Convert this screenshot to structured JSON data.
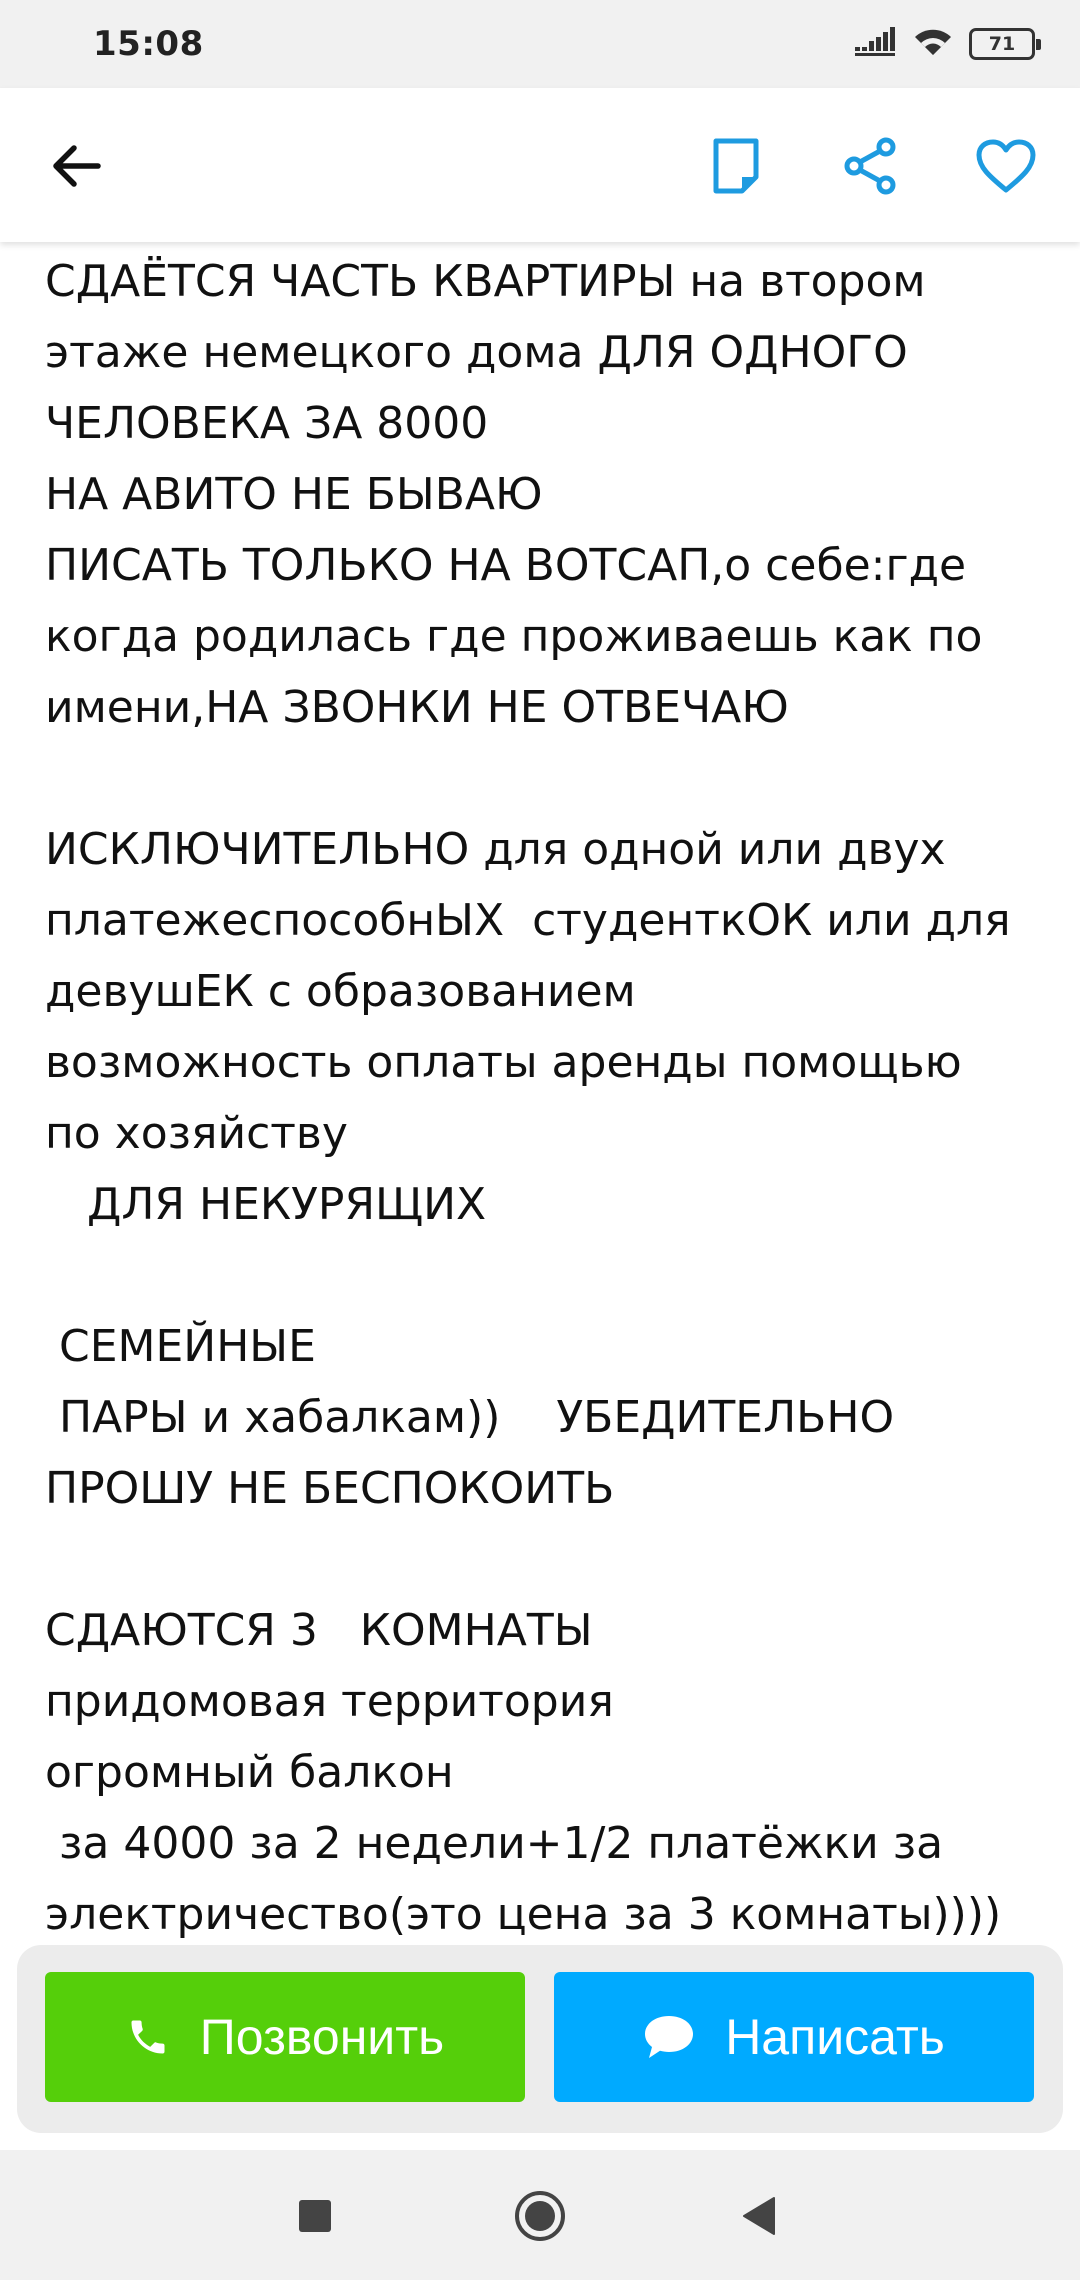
{
  "status_bar": {
    "time": "15:08",
    "battery": "71",
    "icons": [
      "signal-icon",
      "wifi-icon",
      "battery-icon"
    ]
  },
  "app_bar": {
    "icons": [
      "back-arrow-icon",
      "note-icon",
      "share-icon",
      "heart-icon"
    ],
    "accent_color": "#1e9be0"
  },
  "description": {
    "lines": [
      "СДАЁТСЯ ЧАСТЬ КВАРТИРЫ на втором",
      "этаже немецкого дома ДЛЯ ОДНОГО",
      "ЧЕЛОВЕКА ЗА 8000",
      "НА АВИТО НЕ БЫВАЮ",
      "ПИСАТЬ ТОЛЬКО НА ВОТСАП,о себе:где",
      "когда родилась где проживаешь как по",
      "имени,НА ЗВОНКИ НЕ ОТВЕЧАЮ",
      "",
      "ИСКЛЮЧИТЕЛЬНО для одной или двух",
      "платежеспособнЫХ  студенткОК или для",
      "девушЕК с образованием",
      "возможность оплаты аренды помощью",
      "по хозяйству",
      "   ДЛЯ НЕКУРЯЩИХ",
      "",
      " СЕМЕЙНЫЕ",
      " ПАРЫ и хабалкам))    УБЕДИТЕЛЬНО",
      "ПРОШУ НЕ БЕСПОКОИТЬ",
      "",
      "СДАЮТСЯ 3   КОМНАТЫ",
      "придомовая территория",
      "огромный балкон",
      " за 4000 за 2 недели+1/2 платёжки за",
      "электричество(это цена за 3 комнаты))))"
    ]
  },
  "actions": {
    "call_label": "Позвонить",
    "write_label": "Написать",
    "call_color": "#55cf0a",
    "write_color": "#00aaff"
  },
  "nav_bar": {
    "icons": [
      "recents-square-icon",
      "home-circle-icon",
      "back-triangle-icon"
    ]
  }
}
